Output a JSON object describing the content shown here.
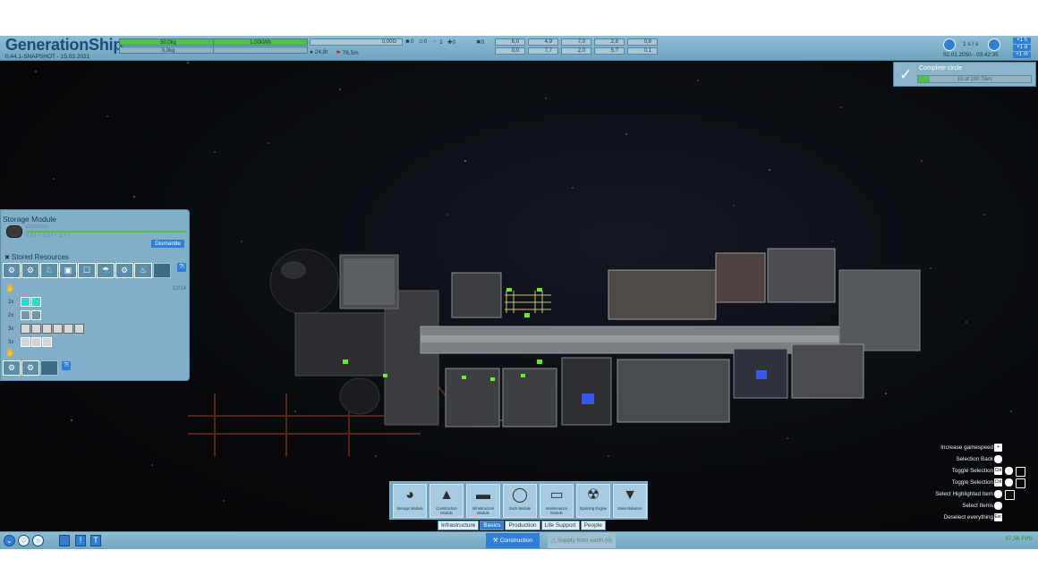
{
  "topbar": {
    "title": "GenerationShip",
    "version": "0.44.1-SNAPSHOT - 15.03.2021",
    "mass_top": "50,0kg",
    "mass_bottom": "0,0kg",
    "energy": "1,00kWh",
    "gravity": "0,00G",
    "temperature": "24,8t",
    "distance": "78,5m",
    "counters": [
      "0",
      "0",
      "1",
      "0",
      "0"
    ],
    "stats_top": [
      "6,0",
      "4,9",
      "7,0",
      "2,8",
      "0,8"
    ],
    "stats_bottom": [
      "0,0",
      "7,7",
      "2,0",
      "5,7",
      "0,1"
    ],
    "speed": "1 s / s",
    "speed_buttons": [
      "+1 h",
      "+1 d",
      "+1 m"
    ],
    "datetime": "02.01.2050 - 03:42:35"
  },
  "goal": {
    "title": "Complete circle",
    "progress_text": "10 of 100 Tiles",
    "progress": 0.1
  },
  "storage_panel": {
    "title": "Storage Module",
    "condition_label": "Condition",
    "condition_values": "0,5 t + 1,2 t + 1,7 t",
    "dismantle_label": "Dismantle",
    "stored_resources_label": "Stored Resources",
    "capacity": "12/14",
    "row_multipliers": [
      "2x",
      "2x",
      "3x",
      "3x"
    ],
    "help_icon": "?!"
  },
  "build_menu": {
    "items": [
      {
        "label": "Storage Module",
        "icon": "storage-module-icon"
      },
      {
        "label": "Construction Module",
        "icon": "construction-module-icon"
      },
      {
        "label": "Infrastructure Module",
        "icon": "infrastructure-module-icon"
      },
      {
        "label": "Dock Module",
        "icon": "dock-module-icon"
      },
      {
        "label": "Maintenance Module",
        "icon": "maintenance-module-icon"
      },
      {
        "label": "Spinning Engine",
        "icon": "spinning-engine-icon"
      },
      {
        "label": "Mass Balancer",
        "icon": "mass-balancer-icon"
      }
    ],
    "tabs": [
      "Infrastructure",
      "Basics",
      "Production",
      "Life Support",
      "People"
    ],
    "active_tab": "Basics"
  },
  "bottombar": {
    "construction_label": "Construction",
    "supply_label": "Supply from earth (0)",
    "fps": "37,56 FPS"
  },
  "hotkeys": [
    {
      "label": "Increase gamespeed"
    },
    {
      "label": "Selection Back"
    },
    {
      "label": "Toggle Selection",
      "key": "Ctrl"
    },
    {
      "label": "Toggle Selection",
      "key": "Ctrl"
    },
    {
      "label": "Select Highlighted Item"
    },
    {
      "label": "Select Items"
    },
    {
      "label": "Deselect everything",
      "key": "Esc"
    }
  ],
  "colors": {
    "ui_panel": "#8cbcd6",
    "ui_accent": "#2f7fd6",
    "progress_green": "#4fc04a",
    "space": "#07090c"
  }
}
